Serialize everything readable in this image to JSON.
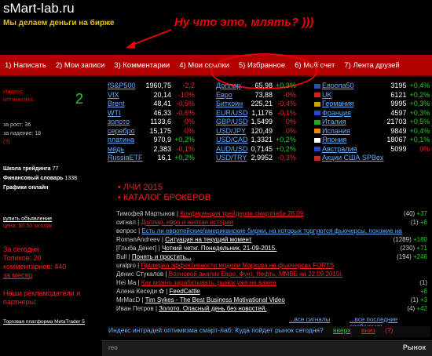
{
  "site": {
    "title": "sMart-lab.ru",
    "tagline": "Мы делаем деньги на бирже"
  },
  "annotation": "Ну что это, млять? )))",
  "nav": [
    "1) Написать",
    "2) Мои записи",
    "3) Комментарии",
    "4) Мои ссылки",
    "5) Избранное",
    "6) Мой счет",
    "7) Лента друзей"
  ],
  "left": {
    "index_label1": "Индекс",
    "index_label2": "оптимизма:",
    "index_value": "2",
    "growth": "за рост: 36",
    "fall": "за падение: 18",
    "question": "(?)",
    "school": "Школа трейдинга",
    "school_count": "77",
    "dictionary": "Финансовый словарь",
    "dictionary_count": "1338",
    "charts": "Графики онлайн",
    "buy_ad": "купить объявление",
    "ad_price": "цена: $0.50 за клик",
    "today_title": "За сегодня",
    "topics": "Топиков: 20",
    "comments": "комментариев: 440",
    "month": "за месяц",
    "advertisers": "Наши рекламодатели и партнеры:",
    "platform": "Торговая платформа MetaTrader 5"
  },
  "quotes": {
    "col1": [
      {
        "name": "fS&P500",
        "value": "1960,75",
        "change": "-2,2",
        "sign": "neg"
      },
      {
        "name": "VIX",
        "value": "20,14",
        "change": "-10%",
        "sign": "neg"
      },
      {
        "name": "Brent",
        "value": "48,41",
        "change": "-0,5%",
        "sign": "neg"
      },
      {
        "name": "WTI",
        "value": "46,33",
        "change": "-0,6%",
        "sign": "neg"
      },
      {
        "name": "золото",
        "value": "1133,6",
        "change": "0%",
        "sign": "neg"
      },
      {
        "name": "серебро",
        "value": "15,175",
        "change": "0%",
        "sign": "neg"
      },
      {
        "name": "платина",
        "value": "970,9",
        "change": "+0,2%",
        "sign": "pos"
      },
      {
        "name": "медь",
        "value": "2,383",
        "change": "-0,1%",
        "sign": "neg"
      },
      {
        "name": "RussiaETF",
        "value": "16,1",
        "change": "+0,2%",
        "sign": "pos"
      }
    ],
    "col2": [
      {
        "name": "Доллар",
        "value": "65,98",
        "change": "+0,3%",
        "sign": "pos"
      },
      {
        "name": "Евро",
        "value": "73,88",
        "change": "-0%",
        "sign": "neg"
      },
      {
        "name": "Биткоин",
        "value": "225,21",
        "change": "-0,4%",
        "sign": "neg"
      },
      {
        "name": "EUR/USD",
        "value": "1,1176",
        "change": "-0,1%",
        "sign": "neg"
      },
      {
        "name": "GBP/USD",
        "value": "1,5499",
        "change": "0%",
        "sign": "neg"
      },
      {
        "name": "USD/JPY",
        "value": "120,49",
        "change": "0%",
        "sign": "neg"
      },
      {
        "name": "USD/CAD",
        "value": "1,3321",
        "change": "+0,2%",
        "sign": "pos"
      },
      {
        "name": "AUD/USD",
        "value": "0,7145",
        "change": "+0,2%",
        "sign": "pos"
      },
      {
        "name": "USD/TRY",
        "value": "2,9952",
        "change": "-0,3%",
        "sign": "neg"
      }
    ],
    "col3": [
      {
        "name": "Европа50",
        "value": "3195",
        "change": "+0,4%",
        "sign": "pos",
        "flag": "#2a4fb0"
      },
      {
        "name": "UK",
        "value": "6121",
        "change": "+0,2%",
        "sign": "pos",
        "flag": "#c22"
      },
      {
        "name": "Германия",
        "value": "9995",
        "change": "+0,3%",
        "sign": "pos",
        "flag": "#d4a000"
      },
      {
        "name": "Франция",
        "value": "4597",
        "change": "+0,3%",
        "sign": "pos",
        "flag": "#24c"
      },
      {
        "name": "Италия",
        "value": "21703",
        "change": "+0,5%",
        "sign": "pos",
        "flag": "#2a2"
      },
      {
        "name": "Испания",
        "value": "9849",
        "change": "+0,4%",
        "sign": "pos",
        "flag": "#e80"
      },
      {
        "name": "Япония",
        "value": "18067",
        "change": "+0,1%",
        "sign": "pos",
        "flag": "#fff"
      },
      {
        "name": "Австралия",
        "value": "5099",
        "change": "0%",
        "sign": "neg",
        "flag": "#24c"
      },
      {
        "name": "Акции США SPBex",
        "value": "",
        "change": "",
        "sign": "neg",
        "flag": "#c22"
      }
    ]
  },
  "promo": {
    "item1": "ЛЧИ 2015",
    "item2": "КАТАЛОГ БРОКЕРОВ"
  },
  "feed": [
    {
      "author": "Тимофей Мартынов",
      "sep": " | ",
      "title": "Конференция трейдеров смартлаба 26.09",
      "style": "red",
      "count": "(40) ",
      "plus": "+37"
    },
    {
      "author": "сигнал",
      "sep": " | ",
      "title": "Доллар, евро и желтая история",
      "style": "red",
      "count": "(1) ",
      "plus": "+6"
    },
    {
      "author": "вопрос",
      "sep": " | ",
      "title": "Есть ли европейские/американские биржи, на которых торгуются фьючерсы, похожие на",
      "style": "blue",
      "count": "",
      "plus": ""
    },
    {
      "author": "RomanAndreev",
      "sep": " | ",
      "title": "Ситуация на текущий момент",
      "style": "white",
      "count": "(1289) ",
      "plus": "+180"
    },
    {
      "author": "[Глыба Денег]",
      "sep": " | ",
      "title": "Чоткий четкг. Понедельник, 21-09-2015.",
      "style": "white",
      "count": "(230) ",
      "plus": "+71"
    },
    {
      "author": "Bull",
      "sep": " | ",
      "title": "Понять и простить...",
      "style": "white",
      "count": "(194) ",
      "plus": "+246"
    },
    {
      "author": "uralpro",
      "sep": " | ",
      "title": "Проверка эффективности модели Маркова на фьючерсах FORTS",
      "style": "red",
      "count": "",
      "plus": ""
    },
    {
      "author": "Денис Стукалов",
      "sep": " | ",
      "title": "Волновой анализ Евро, Фунт, Нефть, ММВБ на 22.09.2015г.",
      "style": "red",
      "count": "",
      "plus": ""
    },
    {
      "author": "Hei Ma",
      "sep": " | ",
      "title": "Как можно зарабатывать, рынок уже не важен",
      "style": "red",
      "count": "(1) ",
      "plus": ""
    },
    {
      "author": "Алена Кеседи ✿",
      "sep": " | ",
      "title": "FeedCattle",
      "style": "white",
      "count": "",
      "plus": "+6"
    },
    {
      "author": "MrMacD",
      "sep": " | ",
      "title": "Tim Sykes - The Best Business Motivational Video",
      "style": "white",
      "count": "(1) ",
      "plus": "+3"
    },
    {
      "author": "Иван Петров",
      "sep": " | ",
      "title": "Золото. Опасный день без новостей.",
      "style": "white",
      "count": "(4) ",
      "plus": "+42"
    }
  ],
  "feed_footer": {
    "all_signals": "...все сигналы",
    "all_posts": "...все последние сообщения"
  },
  "poll": {
    "question": "Индекс интрадей оптимизма смарт-лаб: Куда пойдет рынок сегодня?",
    "up": "вверх",
    "down": "вниз",
    "q": "(?)"
  },
  "bottom": {
    "left": "гео",
    "right": "Рынок"
  },
  "colors": {
    "nav_bg": "#b00000",
    "accent_red": "#e00000",
    "positive": "#22cc22",
    "link_blue": "#66aaff"
  }
}
